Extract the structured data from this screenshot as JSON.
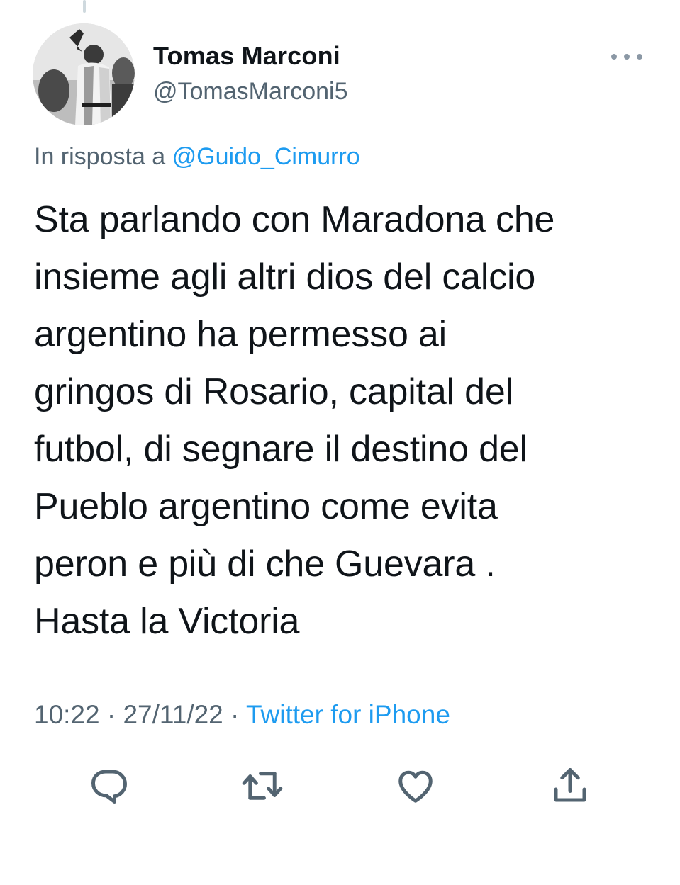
{
  "author": {
    "name": "Tomas Marconi",
    "handle": "@TomasMarconi5"
  },
  "reply": {
    "prefix": "In risposta a",
    "mention": "@Guido_Cimurro"
  },
  "tweet": {
    "text": "Sta parlando con Maradona che\ninsieme agli altri dios del calcio\nargentino ha permesso ai\ngringos di Rosario, capital del\nfutbol, di segnare il destino del\nPueblo argentino come evita\nperon e più di che Guevara .\nHasta la Victoria"
  },
  "meta": {
    "time": "10:22",
    "separator": " · ",
    "date": "27/11/22",
    "source": "Twitter for iPhone"
  },
  "icons": {
    "more": "more-horizontal-icon",
    "reply": "reply-icon",
    "retweet": "retweet-icon",
    "like": "heart-icon",
    "share": "share-icon"
  },
  "colors": {
    "accent": "#1d9bf0",
    "secondary_text": "#536471",
    "primary_text": "#0f1419"
  }
}
